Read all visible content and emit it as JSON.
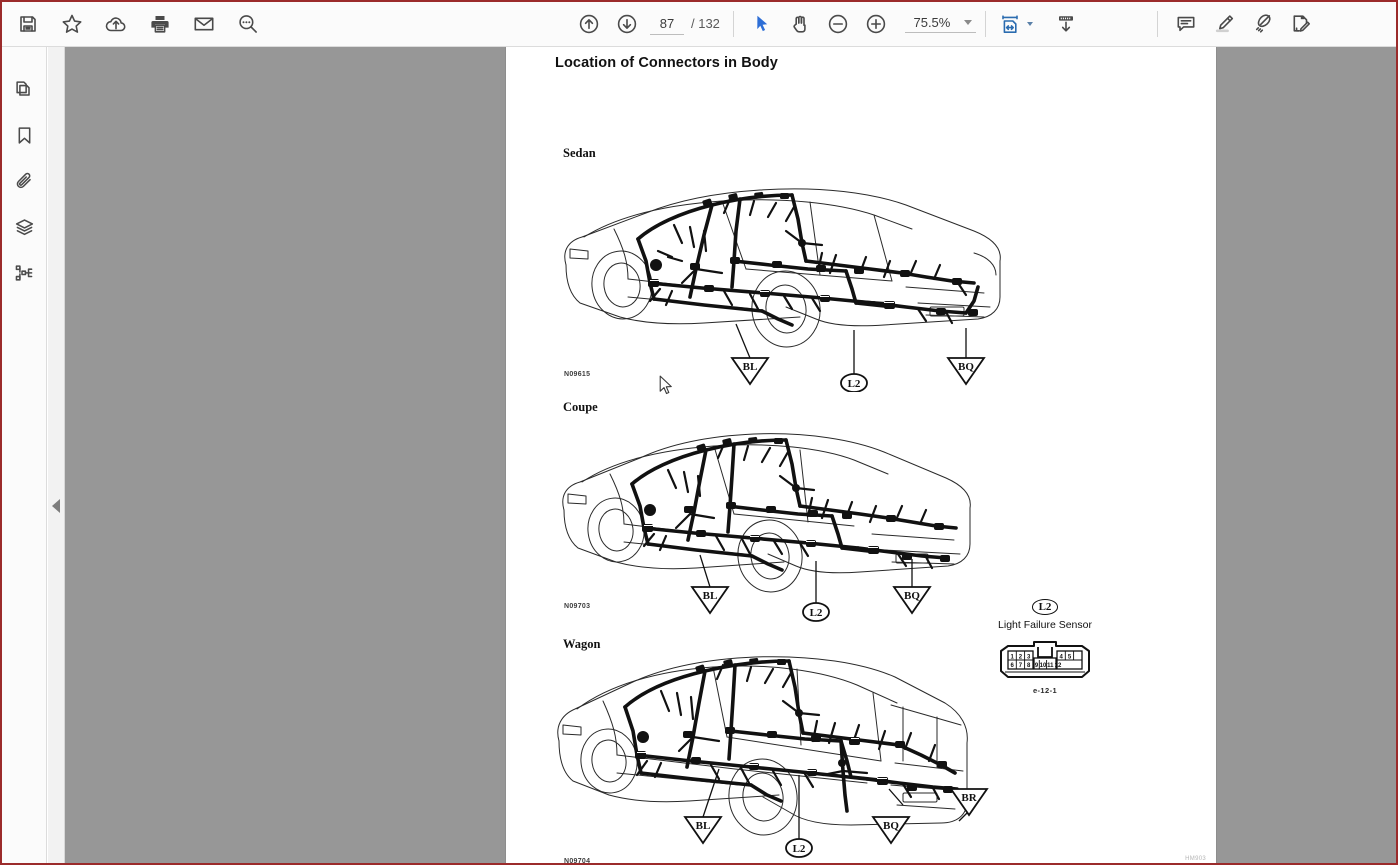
{
  "toolbar": {
    "left_buttons": [
      {
        "name": "save-button",
        "icon": "save-icon",
        "label": "Save"
      },
      {
        "name": "favorite-button",
        "icon": "star-icon",
        "label": "Add to favorites"
      },
      {
        "name": "upload-button",
        "icon": "cloud-upload-icon",
        "label": "Upload to cloud"
      },
      {
        "name": "print-button",
        "icon": "printer-icon",
        "label": "Print"
      },
      {
        "name": "email-button",
        "icon": "envelope-icon",
        "label": "Email"
      },
      {
        "name": "search-button",
        "icon": "search-icon",
        "label": "Search"
      }
    ],
    "navigation": {
      "prev_page_label": "Previous page",
      "next_page_label": "Next page",
      "page_number": "87",
      "page_total": "/ 132",
      "page_placeholder": "87"
    },
    "tools": {
      "select_label": "Select tool",
      "pan_label": "Pan tool",
      "zoom_out_label": "Zoom out",
      "zoom_in_label": "Zoom in",
      "zoom_value": "75.5%",
      "fit_page_label": "Fit page",
      "scroll_mode_label": "Scroll mode"
    },
    "annotate": [
      {
        "name": "comment-button",
        "icon": "comment-icon",
        "label": "Add comment"
      },
      {
        "name": "highlight-button",
        "icon": "highlighter-icon",
        "label": "Highlight"
      },
      {
        "name": "draw-button",
        "icon": "pen-icon",
        "label": "Draw"
      },
      {
        "name": "sign-button",
        "icon": "signature-icon",
        "label": "Sign document"
      }
    ]
  },
  "sidebar": {
    "items": [
      {
        "name": "sidebar-item-thumbnails",
        "icon": "pages-icon",
        "label": "Page thumbnails"
      },
      {
        "name": "sidebar-item-bookmarks",
        "icon": "bookmark-icon",
        "label": "Bookmarks"
      },
      {
        "name": "sidebar-item-attachments",
        "icon": "paperclip-icon",
        "label": "Attachments"
      },
      {
        "name": "sidebar-item-layers",
        "icon": "layers-icon",
        "label": "Layers"
      },
      {
        "name": "sidebar-item-structure",
        "icon": "tree-icon",
        "label": "Document structure"
      }
    ],
    "collapse_label": "Collapse panel"
  },
  "document": {
    "title": "Location of Connectors in Body",
    "sections": [
      {
        "label": "Sedan",
        "figure_code": "N09615"
      },
      {
        "label": "Coupe",
        "figure_code": "N09703"
      },
      {
        "label": "Wagon",
        "figure_code": "N09704"
      }
    ],
    "callouts_sedan": [
      "BL",
      "L2",
      "BQ"
    ],
    "callouts_coupe": [
      "BL",
      "L2",
      "BQ"
    ],
    "callouts_wagon": [
      "BL",
      "L2",
      "BQ",
      "BR"
    ],
    "legend": {
      "code": "L2",
      "name": "Light Failure Sensor",
      "part_number": "e-12-1",
      "pins_top": [
        "1",
        "2",
        "3",
        "4",
        "5"
      ],
      "pins_bottom": [
        "6",
        "7",
        "8",
        "9",
        "10",
        "11",
        "12"
      ]
    },
    "footnote": "HM903"
  },
  "colors": {
    "accent": "#2b6cb0",
    "toolbar_bg": "#fbfbfb",
    "viewport_bg": "#979797",
    "window_border": "#9b2b2b",
    "icon": "#4a4a4a"
  }
}
